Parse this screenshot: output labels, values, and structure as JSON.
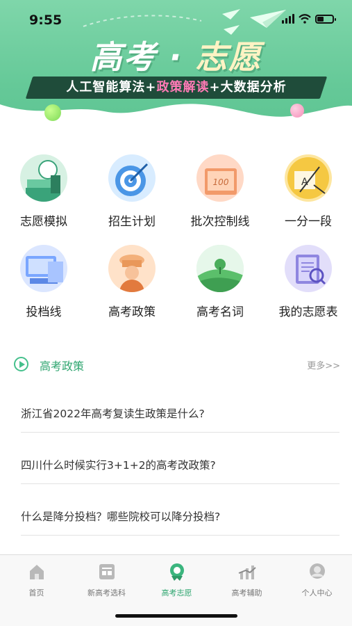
{
  "status_bar": {
    "time": "9:55"
  },
  "hero": {
    "title_a": "高考",
    "title_dot": "·",
    "title_b": "志愿",
    "tagline_a": "人工智能算法+",
    "tagline_b": "政策解读",
    "tagline_c": "+大数据分析"
  },
  "grid": [
    {
      "label": "志愿模拟",
      "icon": "volunteer-simulate-icon"
    },
    {
      "label": "招生计划",
      "icon": "target-icon"
    },
    {
      "label": "批次控制线",
      "icon": "score-line-icon"
    },
    {
      "label": "一分一段",
      "icon": "ranking-icon"
    },
    {
      "label": "投档线",
      "icon": "computer-icon"
    },
    {
      "label": "高考政策",
      "icon": "policy-icon"
    },
    {
      "label": "高考名词",
      "icon": "landscape-icon"
    },
    {
      "label": "我的志愿表",
      "icon": "my-list-icon"
    }
  ],
  "policy": {
    "title": "高考政策",
    "more": "更多>>",
    "items": [
      "浙江省2022年高考复读生政策是什么?",
      "四川什么时候实行3+1+2的高考改政策?",
      "什么是降分投档？哪些院校可以降分投档?"
    ]
  },
  "tabbar": {
    "items": [
      {
        "label": "首页",
        "icon": "home-icon"
      },
      {
        "label": "新高考选科",
        "icon": "subject-icon"
      },
      {
        "label": "高考志愿",
        "icon": "volunteer-icon"
      },
      {
        "label": "高考辅助",
        "icon": "assist-icon"
      },
      {
        "label": "个人中心",
        "icon": "user-icon"
      }
    ],
    "active_index": 2
  },
  "colors": {
    "accent": "#2ea56f",
    "hero": "#65c998"
  }
}
